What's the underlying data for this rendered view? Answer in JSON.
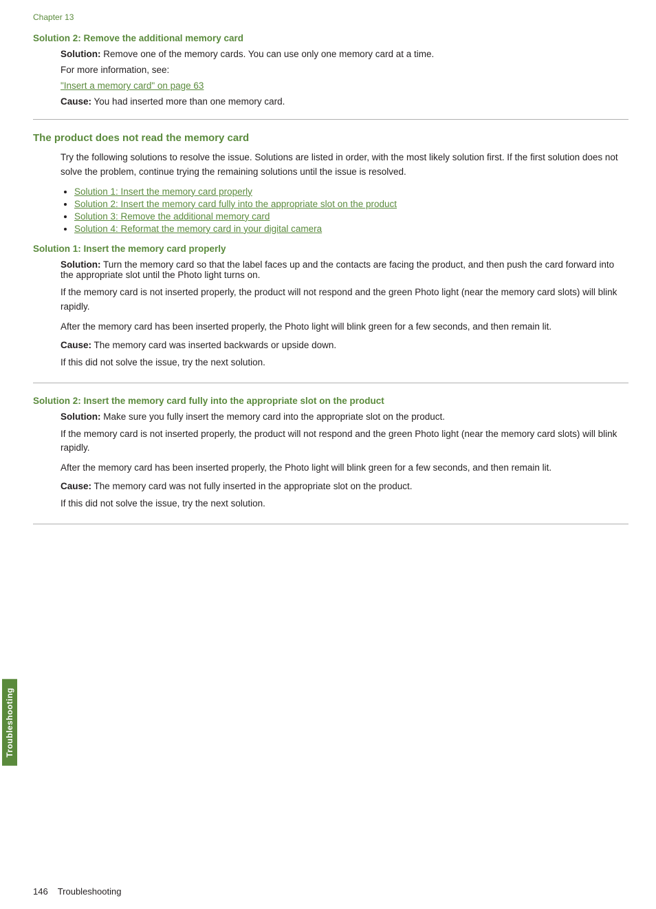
{
  "chapter": "Chapter 13",
  "sidebar_label": "Troubleshooting",
  "section1": {
    "heading": "Solution 2: Remove the additional memory card",
    "solution_label": "Solution:",
    "solution_text": "  Remove one of the memory cards. You can use only one memory card at a time.",
    "more_info": "For more information, see:",
    "link": "\"Insert a memory card\" on page 63",
    "cause_label": "Cause:",
    "cause_text": "  You had inserted more than one memory card."
  },
  "section2": {
    "heading": "The product does not read the memory card",
    "intro": "Try the following solutions to resolve the issue. Solutions are listed in order, with the most likely solution first. If the first solution does not solve the problem, continue trying the remaining solutions until the issue is resolved.",
    "bullets": [
      "Solution 1: Insert the memory card properly",
      "Solution 2: Insert the memory card fully into the appropriate slot on the product",
      "Solution 3: Remove the additional memory card",
      "Solution 4: Reformat the memory card in your digital camera"
    ]
  },
  "sol1": {
    "heading": "Solution 1: Insert the memory card properly",
    "solution_label": "Solution:",
    "solution_text": "  Turn the memory card so that the label faces up and the contacts are facing the product, and then push the card forward into the appropriate slot until the Photo light turns on.",
    "para1": "If the memory card is not inserted properly, the product will not respond and the green Photo light (near the memory card slots) will blink rapidly.",
    "para2": "After the memory card has been inserted properly, the Photo light will blink green for a few seconds, and then remain lit.",
    "cause_label": "Cause:",
    "cause_text": "  The memory card was inserted backwards or upside down.",
    "next_solution": "If this did not solve the issue, try the next solution."
  },
  "sol2": {
    "heading": "Solution 2: Insert the memory card fully into the appropriate slot on the product",
    "solution_label": "Solution:",
    "solution_text": "  Make sure you fully insert the memory card into the appropriate slot on the product.",
    "para1": "If the memory card is not inserted properly, the product will not respond and the green Photo light (near the memory card slots) will blink rapidly.",
    "para2": "After the memory card has been inserted properly, the Photo light will blink green for a few seconds, and then remain lit.",
    "cause_label": "Cause:",
    "cause_text": "  The memory card was not fully inserted in the appropriate slot on the product.",
    "next_solution": "If this did not solve the issue, try the next solution."
  },
  "footer": {
    "page_number": "146",
    "section": "Troubleshooting"
  }
}
